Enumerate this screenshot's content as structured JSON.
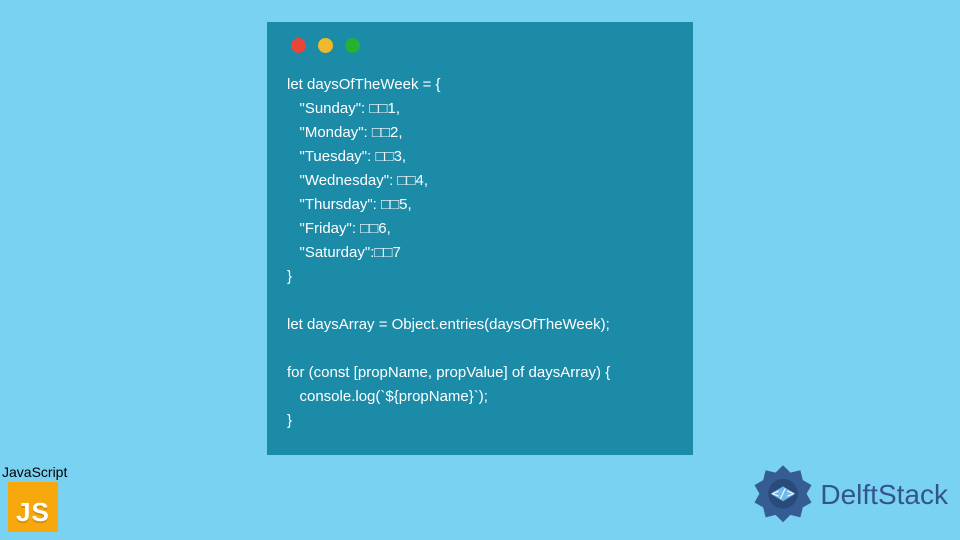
{
  "code": {
    "lines": [
      "let daysOfTheWeek = {",
      "   \"Sunday\": □□1,",
      "   \"Monday\": □□2,",
      "   \"Tuesday\": □□3,",
      "   \"Wednesday\": □□4,",
      "   \"Thursday\": □□5,",
      "   \"Friday\": □□6,",
      "   \"Saturday\":□□7",
      "}",
      "",
      "let daysArray = Object.entries(daysOfTheWeek);",
      "",
      "for (const [propName, propValue] of daysArray) {",
      "   console.log(`${propName}`);",
      "}"
    ]
  },
  "jsBadge": {
    "label": "JavaScript",
    "logoText": "JS"
  },
  "brand": {
    "name": "DelftStack"
  },
  "colors": {
    "bg": "#79d2f2",
    "windowBg": "#1b8ba8",
    "jsLogo": "#f7a80d",
    "brandText": "#33558e"
  }
}
